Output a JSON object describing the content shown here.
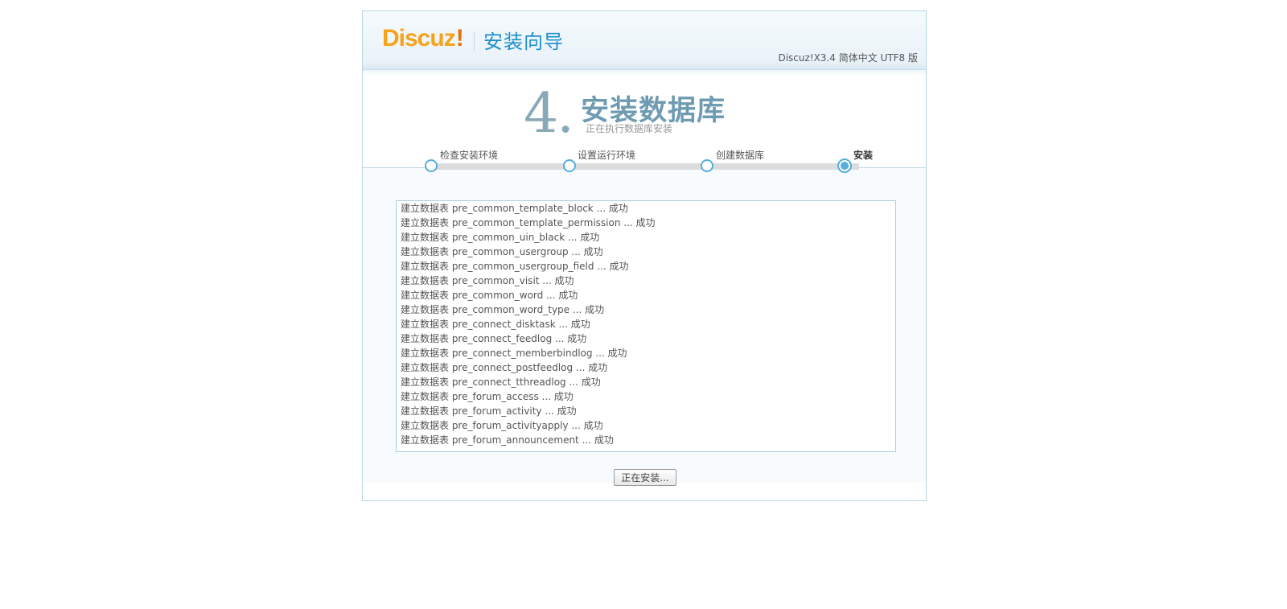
{
  "header": {
    "logo_text": "Discuz",
    "logo_bang": "!",
    "title": "安装向导",
    "version": "Discuz!X3.4 简体中文 UTF8 版"
  },
  "step": {
    "number": "4.",
    "title": "安装数据库",
    "subtitle": "正在执行数据库安装"
  },
  "progress": {
    "steps": [
      {
        "label": "检查安装环境",
        "active": false
      },
      {
        "label": "设置运行环境",
        "active": false
      },
      {
        "label": "创建数据库",
        "active": false
      },
      {
        "label": "安装",
        "active": true
      }
    ]
  },
  "log": [
    "建立数据表 pre_common_template_block ... 成功",
    "建立数据表 pre_common_template_permission ... 成功",
    "建立数据表 pre_common_uin_black ... 成功",
    "建立数据表 pre_common_usergroup ... 成功",
    "建立数据表 pre_common_usergroup_field ... 成功",
    "建立数据表 pre_common_visit ... 成功",
    "建立数据表 pre_common_word ... 成功",
    "建立数据表 pre_common_word_type ... 成功",
    "建立数据表 pre_connect_disktask ... 成功",
    "建立数据表 pre_connect_feedlog ... 成功",
    "建立数据表 pre_connect_memberbindlog ... 成功",
    "建立数据表 pre_connect_postfeedlog ... 成功",
    "建立数据表 pre_connect_tthreadlog ... 成功",
    "建立数据表 pre_forum_access ... 成功",
    "建立数据表 pre_forum_activity ... 成功",
    "建立数据表 pre_forum_activityapply ... 成功",
    "建立数据表 pre_forum_announcement ... 成功"
  ],
  "button": {
    "label": "正在安装..."
  },
  "colors": {
    "accent": "#55aedc",
    "logo": "#f6a21b",
    "title": "#1e8fcc"
  }
}
